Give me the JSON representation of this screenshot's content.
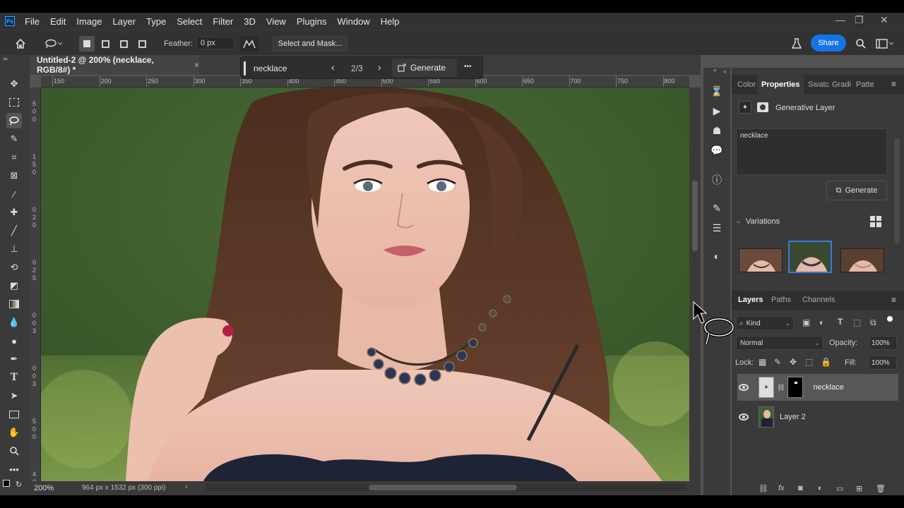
{
  "menu": {
    "logo": "Ps",
    "items": [
      "File",
      "Edit",
      "Image",
      "Layer",
      "Type",
      "Select",
      "Filter",
      "3D",
      "View",
      "Plugins",
      "Window",
      "Help"
    ]
  },
  "options": {
    "feather_label": "Feather:",
    "feather_value": "0 px",
    "select_mask_label": "Select and Mask...",
    "share_label": "Share"
  },
  "document": {
    "tab_title": "Untitled-2 @ 200% (necklace, RGB/8#) *",
    "close": "×"
  },
  "context_bar": {
    "prompt": "necklace",
    "counter": "2/3",
    "generate_label": "Generate",
    "more": "•••"
  },
  "rulers": {
    "top": [
      "150",
      "200",
      "250",
      "300",
      "350",
      "400",
      "450",
      "500",
      "550",
      "600",
      "650",
      "700",
      "750",
      "800"
    ],
    "left": [
      "5",
      "0",
      "0",
      "1",
      "5",
      "0",
      "0",
      "2",
      "0",
      "0",
      "2",
      "5",
      "0",
      "0",
      "3",
      "0",
      "0",
      "3",
      "5",
      "0",
      "0",
      "4",
      "0",
      "0"
    ]
  },
  "status": {
    "zoom": "200%",
    "info": "964 px x 1532 px (300 ppi)"
  },
  "properties": {
    "tabs": [
      "Color",
      "Properties",
      "Swatc",
      "Gradi",
      "Patte"
    ],
    "active_tab": "Properties",
    "layer_type": "Generative Layer",
    "prompt_text": "necklace",
    "generate_label": "Generate",
    "variations_label": "Variations"
  },
  "layers": {
    "tabs": [
      "Layers",
      "Paths",
      "Channels"
    ],
    "kind_label": "Kind",
    "blend_mode": "Normal",
    "opacity_label": "Opacity:",
    "opacity_value": "100%",
    "lock_label": "Lock:",
    "fill_label": "Fill:",
    "fill_value": "100%",
    "items": [
      {
        "name": "necklace",
        "selected": true
      },
      {
        "name": "Layer 2",
        "selected": false
      }
    ]
  },
  "colors": {
    "accent": "#1473e6",
    "panel": "#3a3a3a",
    "selection_border": "#3b7ae0"
  }
}
